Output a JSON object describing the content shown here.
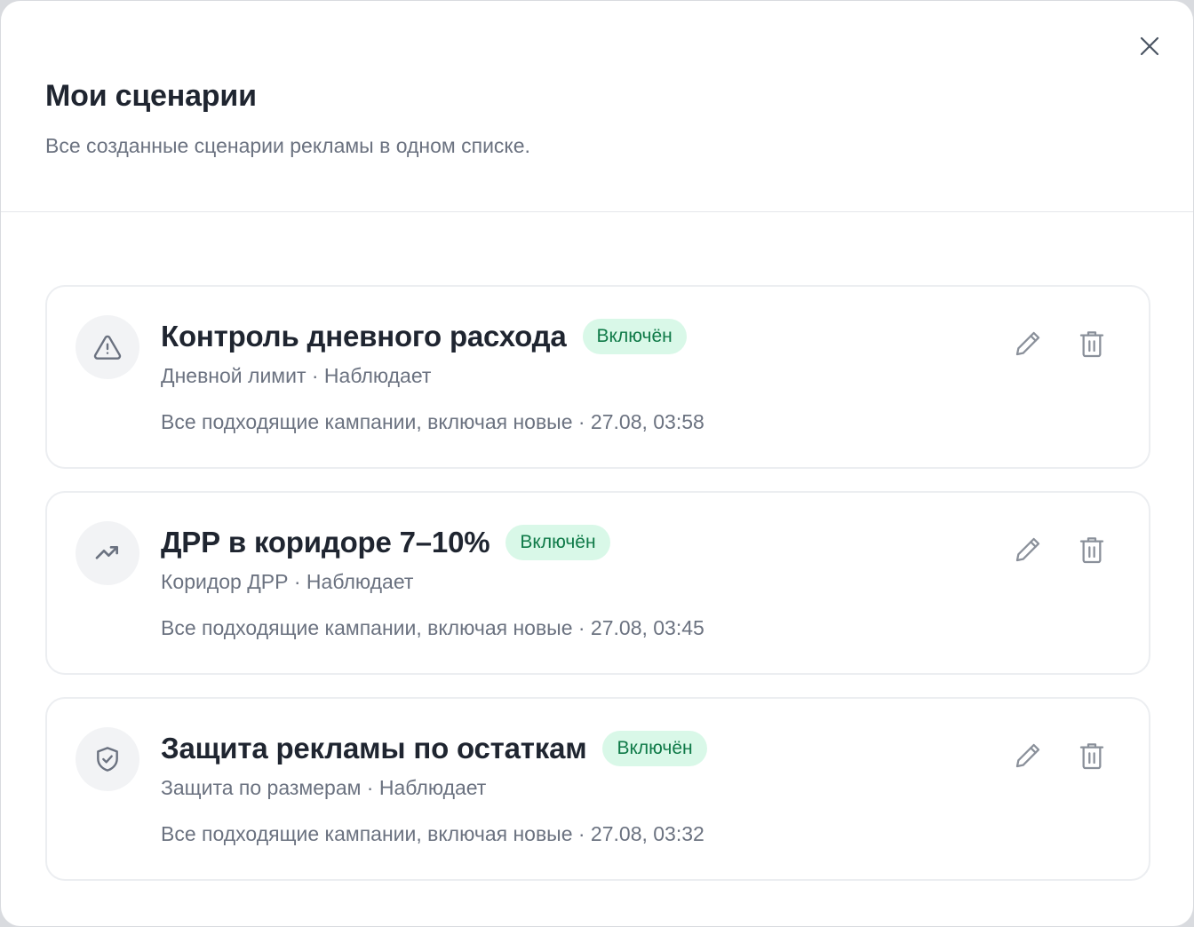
{
  "modal": {
    "title": "Мои сценарии",
    "subtitle": "Все созданные сценарии рекламы в одном списке.",
    "close_icon": "close-icon"
  },
  "scenarios": [
    {
      "icon": "warning-triangle-icon",
      "title": "Контроль дневного расхода",
      "status": "Включён",
      "meta": "Дневной лимит · Наблюдает",
      "scope": "Все подходящие кампании, включая новые · 27.08, 03:58"
    },
    {
      "icon": "trending-up-icon",
      "title": "ДРР в коридоре 7–10%",
      "status": "Включён",
      "meta": "Коридор ДРР · Наблюдает",
      "scope": "Все подходящие кампании, включая новые · 27.08, 03:45"
    },
    {
      "icon": "shield-check-icon",
      "title": "Защита рекламы по остаткам",
      "status": "Включён",
      "meta": "Защита по размерам · Наблюдает",
      "scope": "Все подходящие кампании, включая новые · 27.08, 03:32"
    }
  ],
  "colors": {
    "status_bg": "#d9f8e8",
    "status_text": "#0f7a48",
    "icon_gray": "#6b7280"
  }
}
